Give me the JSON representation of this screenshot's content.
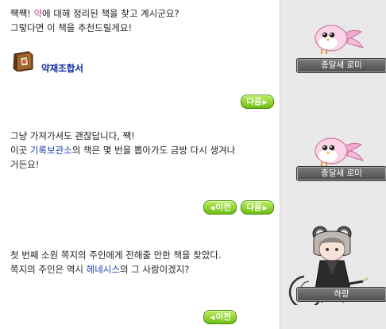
{
  "dialog1": {
    "line1_before": "쨱쨱! ",
    "line1_keyword": "약",
    "line1_after": "에 대해 정리된 책을 찾고 계시군요?",
    "line2": "그렇다면 이 책을 추천드릴게요!",
    "book_label": "약재조합서",
    "next_label": "다음"
  },
  "dialog2": {
    "line1": "그냥 가져가셔도 괜찮답니다, 짹!",
    "line2_before": "이곳 ",
    "line2_keyword": "기록보관소",
    "line2_after": "의 책은 몇 번을 뽑아가도 금방 다시 생겨나",
    "line3": "거든요!",
    "prev_label": "이전",
    "next_label": "다음"
  },
  "dialog3": {
    "line1": "첫 번째 소원 쪽지의 주인에게 전해줄 만한 책을 찾았다.",
    "line2_before": "쪽지의 주인은 역시 ",
    "line2_keyword": "헤네시스",
    "line2_after": "의 그 사람이겠지?",
    "prev_label": "이전"
  },
  "npcs": {
    "npc1_name": "종달새 로미",
    "npc2_name": "종달새 로미",
    "npc3_name": "하랑"
  },
  "icons": {
    "prev_arrow": "◀",
    "next_arrow": "▶"
  }
}
